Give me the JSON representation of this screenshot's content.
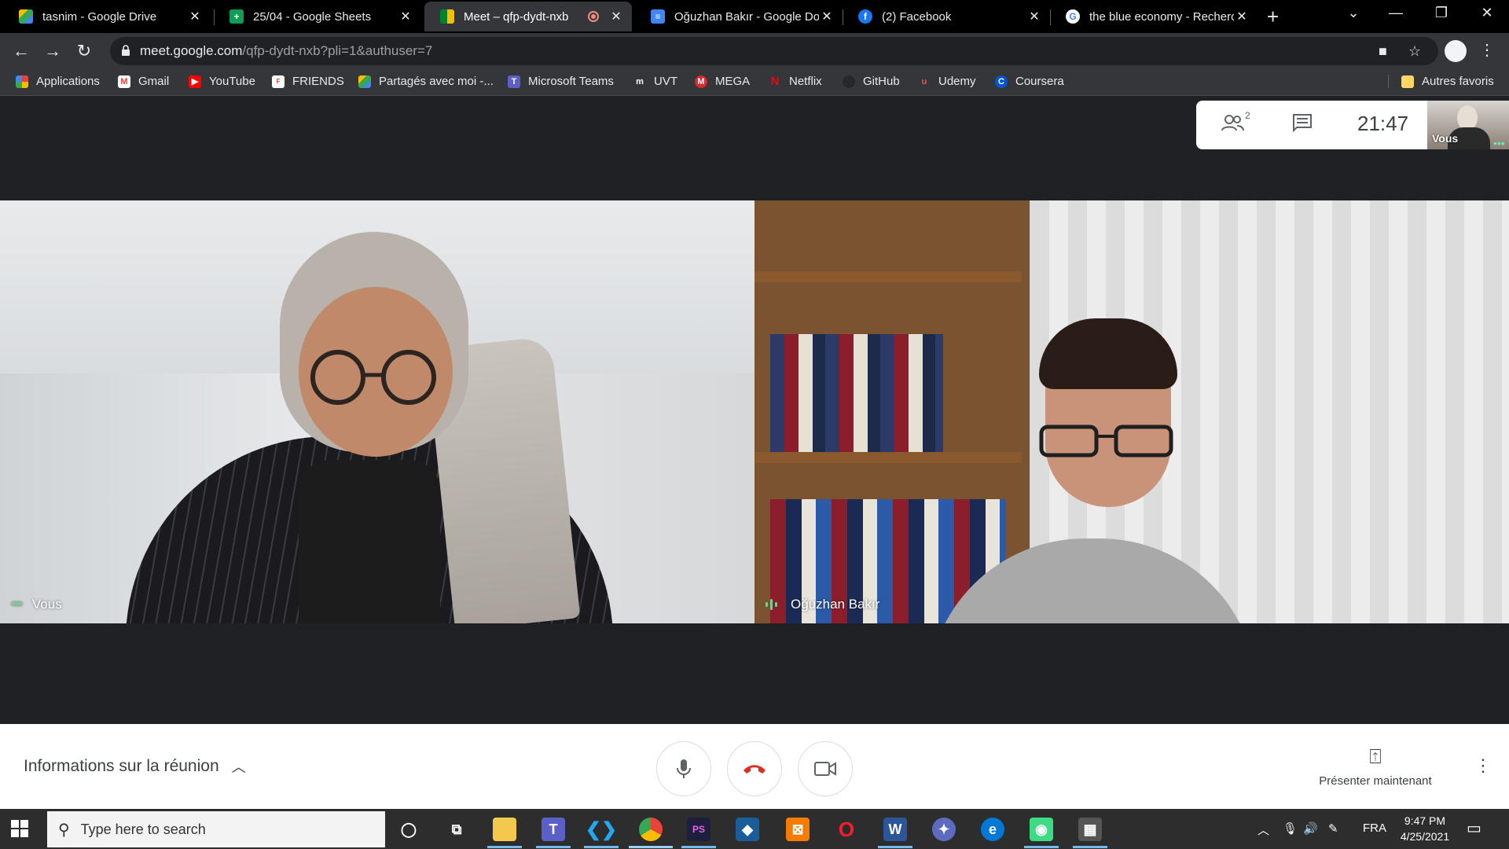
{
  "browser": {
    "tabs": [
      {
        "title": "tasnim - Google Drive",
        "icon": "google-drive-icon",
        "active": false
      },
      {
        "title": "25/04 - Google Sheets",
        "icon": "google-sheets-icon",
        "active": false
      },
      {
        "title": "Meet – qfp-dydt-nxb",
        "icon": "google-meet-icon",
        "active": true
      },
      {
        "title": "Oğuzhan Bakır - Google Do",
        "icon": "google-docs-icon",
        "active": false
      },
      {
        "title": "(2) Facebook",
        "icon": "facebook-icon",
        "active": false
      },
      {
        "title": "the blue economy - Recherc",
        "icon": "google-icon",
        "active": false
      }
    ],
    "url_host": "meet.google.com",
    "url_path": "/qfp-dydt-nxb?pli=1&authuser=7",
    "bookmarks": [
      {
        "label": "Applications",
        "icon": "apps-grid-icon"
      },
      {
        "label": "Gmail",
        "icon": "gmail-icon"
      },
      {
        "label": "YouTube",
        "icon": "youtube-icon"
      },
      {
        "label": "FRIENDS",
        "icon": "friends-icon"
      },
      {
        "label": "Partagés avec moi -...",
        "icon": "google-drive-icon"
      },
      {
        "label": "Microsoft Teams",
        "icon": "teams-icon"
      },
      {
        "label": "UVT",
        "icon": "uvt-icon"
      },
      {
        "label": "MEGA",
        "icon": "mega-icon"
      },
      {
        "label": "Netflix",
        "icon": "netflix-icon"
      },
      {
        "label": "GitHub",
        "icon": "github-icon"
      },
      {
        "label": "Udemy",
        "icon": "udemy-icon"
      },
      {
        "label": "Coursera",
        "icon": "coursera-icon"
      }
    ],
    "other_bookmarks": "Autres favoris"
  },
  "meet": {
    "participant_count": "2",
    "time": "21:47",
    "self_label": "Vous",
    "tiles": [
      {
        "name": "Vous"
      },
      {
        "name": "Oğuzhan Bakır"
      }
    ],
    "meeting_info": "Informations sur la réunion",
    "present_now": "Présenter maintenant"
  },
  "taskbar": {
    "search_placeholder": "Type here to search",
    "language": "FRA",
    "time": "9:47 PM",
    "date": "4/25/2021"
  },
  "colors": {
    "accent_green": "#81c995",
    "hangup_red": "#d93025",
    "meet_bg": "#202124"
  }
}
